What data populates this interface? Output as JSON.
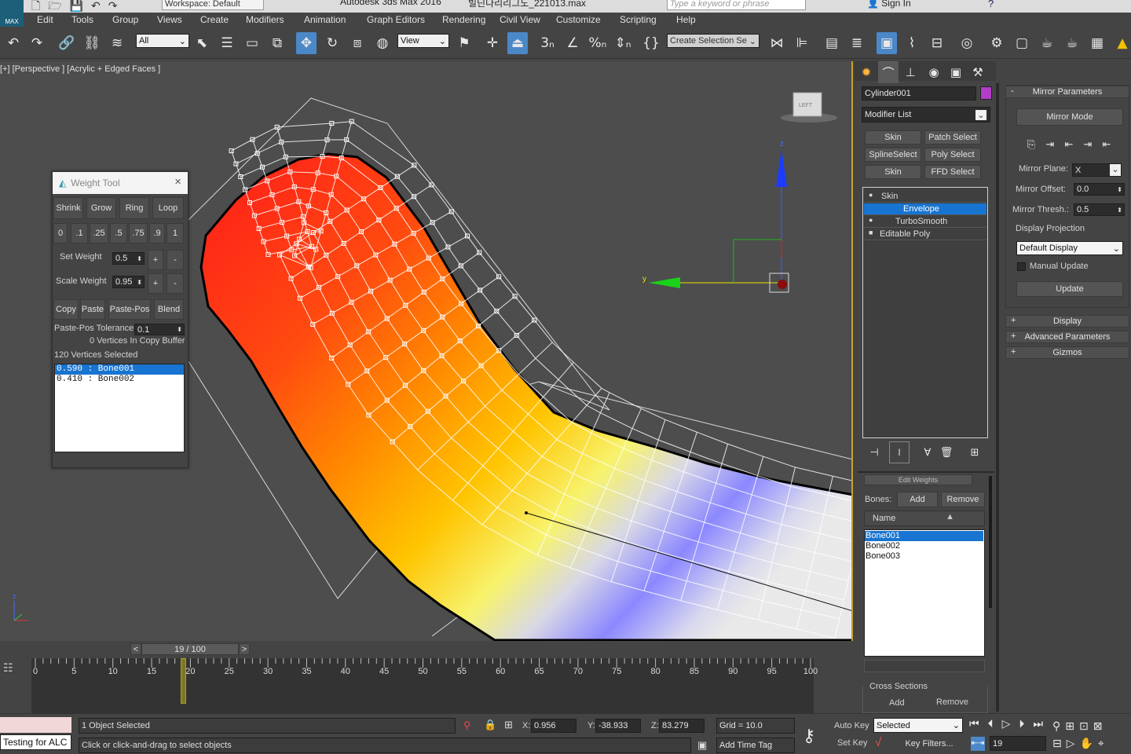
{
  "titlebar": {
    "workspace": "Workspace: Default",
    "app_title": "Autodesk 3ds Max 2016",
    "file_title": "빌딘다리리그도_221013.max",
    "search_placeholder": "Type a keyword or phrase",
    "sign_in": "Sign In",
    "logo": "MAX"
  },
  "menu": [
    "Edit",
    "Tools",
    "Group",
    "Views",
    "Create",
    "Modifiers",
    "Animation",
    "Graph Editors",
    "Rendering",
    "Civil View",
    "Customize",
    "Scripting",
    "Help"
  ],
  "toolbar": {
    "selection_filter": "All",
    "ref_coord": "View",
    "named_selection": "Create Selection Se"
  },
  "viewport": {
    "label": "[+] [Perspective ] [Acrylic + Edged Faces ]",
    "axis_x": "x",
    "axis_y": "y",
    "axis_z": "z",
    "viewcube_label": "LEFT"
  },
  "weight_tool": {
    "title": "Weight Tool",
    "row1": [
      "Shrink",
      "Grow",
      "Ring",
      "Loop"
    ],
    "presets": [
      "0",
      ".1",
      ".25",
      ".5",
      ".75",
      ".9",
      "1"
    ],
    "set_weight_label": "Set Weight",
    "set_weight_value": "0.5",
    "scale_weight_label": "Scale Weight",
    "scale_weight_value": "0.95",
    "plus": "+",
    "minus": "-",
    "row4": [
      "Copy",
      "Paste",
      "Paste-Pos",
      "Blend"
    ],
    "tolerance_label": "Paste-Pos Tolerance",
    "tolerance_value": "0.1",
    "copy_buffer": "0 Vertices In Copy Buffer",
    "selected_count": "120 Vertices Selected",
    "weights": [
      "0.590 : Bone001",
      "0.410 : Bone002"
    ]
  },
  "command_panel": {
    "object_name": "Cylinder001",
    "object_color": "#b33cc8",
    "modifier_list": "Modifier List",
    "mod_buttons": [
      "Skin",
      "Patch Select",
      "SplineSelect",
      "Poly Select",
      "Skin",
      "FFD Select"
    ],
    "stack": [
      "Skin",
      "Envelope",
      "TurboSmooth",
      "Editable Poly"
    ],
    "bones_label": "Bones:",
    "add": "Add",
    "remove": "Remove",
    "name_header": "Name",
    "bones": [
      "Bone001",
      "Bone002",
      "Bone003"
    ],
    "cross_sections": "Cross Sections",
    "cs_add": "Add",
    "cs_remove": "Remove",
    "edit_weights_hint": "Edit Weights"
  },
  "mirror": {
    "title": "Mirror Parameters",
    "mode": "Mirror Mode",
    "plane_label": "Mirror Plane:",
    "plane_value": "X",
    "offset_label": "Mirror Offset:",
    "offset_value": "0.0",
    "thresh_label": "Mirror Thresh.:",
    "thresh_value": "0.5",
    "projection_label": "Display Projection",
    "projection_value": "Default Display",
    "manual_update": "Manual Update",
    "update": "Update",
    "rollouts": [
      "Display",
      "Advanced Parameters",
      "Gizmos"
    ]
  },
  "timeline": {
    "frame": "19 / 100",
    "ticks": [
      "0",
      "5",
      "10",
      "15",
      "20",
      "25",
      "30",
      "35",
      "40",
      "45",
      "50",
      "55",
      "60",
      "65",
      "70",
      "75",
      "80",
      "85",
      "90",
      "95",
      "100"
    ],
    "current_frame": 19,
    "total_frames": 100
  },
  "status": {
    "listener": "Testing for ALC",
    "selected": "1 Object Selected",
    "prompt": "Click or click-and-drag to select objects",
    "x_label": "X:",
    "x": "0.956",
    "y_label": "Y:",
    "y": "-38.933",
    "z_label": "Z:",
    "z": "83.279",
    "grid": "Grid = 10.0",
    "add_time_tag": "Add Time Tag",
    "auto_key": "Auto Key",
    "set_key": "Set Key",
    "key_mode": "Selected",
    "key_filters": "Key Filters...",
    "frame_field": "19"
  }
}
